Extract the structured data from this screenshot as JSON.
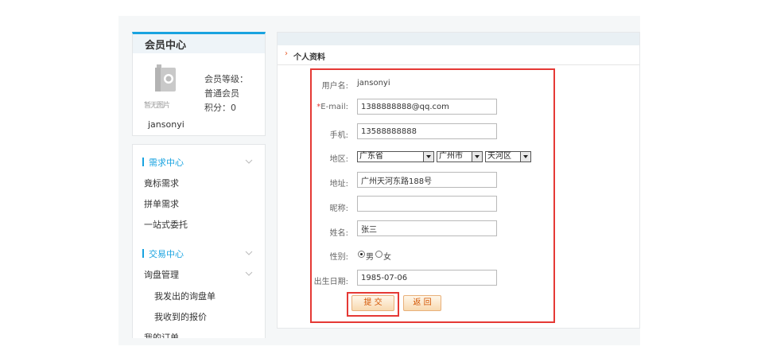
{
  "member": {
    "title": "会员中心",
    "avatar_caption": "暂无图片",
    "level_label": "会员等级：",
    "level_value": "普通会员",
    "points": "积分：0",
    "username": "jansonyi"
  },
  "menu": {
    "demand_head": "需求中心",
    "bid_demand": "竟标需求",
    "group_demand": "拼单需求",
    "one_stop": "一站式委托",
    "trade_head": "交易中心",
    "inquiry_mgmt": "询盘管理",
    "my_inquiries": "我发出的询盘单",
    "my_quotes": "我收到的报价",
    "my_orders": "我的订单"
  },
  "breadcrumb": "个人资料",
  "form": {
    "username_label": "用户名:",
    "username_value": "jansonyi",
    "email_required": "*",
    "email_label": "E-mail:",
    "email_value": "1388888888@qq.com",
    "phone_label": "手机:",
    "phone_value": "13588888888",
    "region_label": "地区:",
    "province": "广东省",
    "city": "广州市",
    "district": "天河区",
    "address_label": "地址:",
    "address_value": "广州天河东路188号",
    "nickname_label": "昵称:",
    "nickname_value": "",
    "name_label": "姓名:",
    "name_value": "张三",
    "gender_label": "性别:",
    "gender_male": "男",
    "gender_female": "女",
    "birth_label": "出生日期:",
    "birth_value": "1985-07-06",
    "submit": "提 交",
    "back": "返 回"
  },
  "colors": {
    "accent": "#19a3e0",
    "highlight": "#e53935",
    "button_text": "#d35400"
  }
}
